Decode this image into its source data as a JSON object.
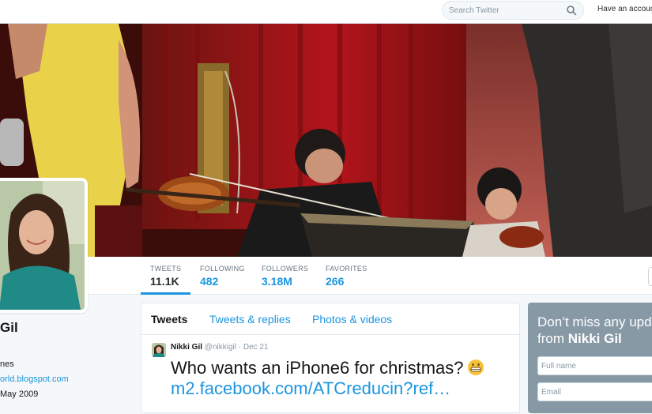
{
  "topbar": {
    "search_placeholder": "Search Twitter",
    "have_account": "Have an account"
  },
  "stats": [
    {
      "label": "TWEETS",
      "value": "11.1K"
    },
    {
      "label": "FOLLOWING",
      "value": "482"
    },
    {
      "label": "FOLLOWERS",
      "value": "3.18M"
    },
    {
      "label": "FAVORITES",
      "value": "266"
    }
  ],
  "profile": {
    "name_visible": "Gil",
    "location_visible": "nes",
    "website_visible": "orld.blogspot.com",
    "joined_visible": "May 2009"
  },
  "timeline": {
    "tabs": [
      "Tweets",
      "Tweets & replies",
      "Photos & videos"
    ],
    "tweet": {
      "name": "Nikki Gil",
      "handle": "@nikkigil",
      "sep": "·",
      "date": "Dec 21",
      "text": "Who wants an iPhone6 for christmas?",
      "emoji": "grinning-face-emoji",
      "link": "m2.facebook.com/ATCreducin?ref…"
    }
  },
  "signup": {
    "title_line1": "Don’t miss any upd",
    "title_prefix": "from ",
    "title_name": "Nikki Gil",
    "fullname_placeholder": "Full name",
    "email_placeholder": "Email"
  },
  "colors": {
    "accent": "#1b95e0",
    "cover_curtain": "#b3141b",
    "signup_bg": "#8899a6",
    "background": "#f5f8fa"
  }
}
